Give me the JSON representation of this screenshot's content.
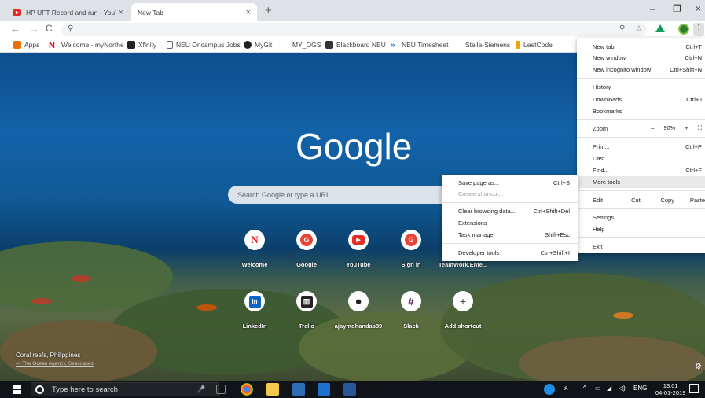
{
  "browser": {
    "tabs": [
      {
        "title": "HP UFT Record and run - YouTub",
        "close": "×"
      },
      {
        "title": "New Tab",
        "close": "×"
      }
    ],
    "new_tab_symbol": "+",
    "window_controls": {
      "minimize": "–",
      "maximize": "❐",
      "close": "×"
    },
    "nav": {
      "back": "←",
      "forward": "→",
      "reload": "C"
    },
    "omnibox": {
      "value": "",
      "search_icon": "search-icon",
      "zoom_icon": "zoom-icon",
      "star_icon": "star-icon"
    },
    "menu_dots": "⋮"
  },
  "bookmarks": [
    {
      "label": "Apps",
      "icon": "apps-grid-icon",
      "color": "#e8710a"
    },
    {
      "label": "Welcome - myNorthe",
      "icon": "netflix-n-icon",
      "color": "#e50914"
    },
    {
      "label": "Xfinity",
      "icon": "xfinity-icon",
      "color": "#222222"
    },
    {
      "label": "NEU Oncampus Jobs",
      "icon": "page-icon",
      "color": "#ffffff"
    },
    {
      "label": "MyGit",
      "icon": "github-icon",
      "color": "#222222"
    },
    {
      "label": "MY_OGS",
      "icon": "",
      "color": "#ffffff"
    },
    {
      "label": "Blackboard NEU",
      "icon": "blackboard-icon",
      "color": "#333333"
    },
    {
      "label": "NEU Timesheet",
      "icon": "chevron-icon",
      "color": "#1a73e8"
    },
    {
      "label": "Stella-Siemens",
      "icon": "",
      "color": "#ffffff"
    },
    {
      "label": "LeetCode",
      "icon": "leetcode-icon",
      "color": "#f0a500"
    }
  ],
  "ntp": {
    "logo": "Google",
    "search_placeholder": "Search Google or type a URL",
    "shortcuts_row1": [
      {
        "label": "Welcome",
        "letter": "N",
        "color": "#e50914"
      },
      {
        "label": "Google",
        "letter": "G",
        "color": "#ea4335"
      },
      {
        "label": "YouTube",
        "letter": "▶",
        "color": "#e52d27"
      },
      {
        "label": "Sign in",
        "letter": "G",
        "color": "#ea4335"
      },
      {
        "label": "TeamWork.Ente...",
        "letter": "",
        "color": "#333333"
      }
    ],
    "shortcuts_row2": [
      {
        "label": "LinkedIn",
        "letter": "in",
        "color": "#0a66c2"
      },
      {
        "label": "Trello",
        "letter": "▥",
        "color": "#222222"
      },
      {
        "label": "ajaymohandas89",
        "letter": "●",
        "color": "#222222"
      },
      {
        "label": "Slack",
        "letter": "#",
        "color": "#4a154b"
      },
      {
        "label": "Add shortcut",
        "letter": "+",
        "color": "#444444"
      }
    ],
    "credit": "Coral reefs, Philippines",
    "credit_sub": "— The Ocean Agency, Seascapes"
  },
  "chrome_menu": {
    "new_tab": {
      "label": "New tab",
      "shortcut": "Ctrl+T"
    },
    "new_window": {
      "label": "New window",
      "shortcut": "Ctrl+N"
    },
    "incognito": {
      "label": "New incognito window",
      "shortcut": "Ctrl+Shift+N"
    },
    "history": "History",
    "downloads": {
      "label": "Downloads",
      "shortcut": "Ctrl+J"
    },
    "bookmarks": "Bookmarks",
    "zoom": {
      "label": "Zoom",
      "minus": "–",
      "value": "90%",
      "plus": "+",
      "fullscreen": "⛶"
    },
    "print": {
      "label": "Print...",
      "shortcut": "Ctrl+P"
    },
    "cast": "Cast...",
    "find": {
      "label": "Find...",
      "shortcut": "Ctrl+F"
    },
    "more_tools": "More tools",
    "edit": {
      "label": "Edit",
      "cut": "Cut",
      "copy": "Copy",
      "paste": "Paste"
    },
    "settings": "Settings",
    "help": "Help",
    "exit": "Exit"
  },
  "more_tools_menu": {
    "save_page": {
      "label": "Save page as...",
      "shortcut": "Ctrl+S"
    },
    "create_shortcut": "Create shortcut...",
    "clear_browsing": {
      "label": "Clear browsing data...",
      "shortcut": "Ctrl+Shift+Del"
    },
    "extensions": "Extensions",
    "task_manager": {
      "label": "Task manager",
      "shortcut": "Shift+Esc"
    },
    "dev_tools": {
      "label": "Developer tools",
      "shortcut": "Ctrl+Shift+I"
    }
  },
  "taskbar": {
    "search_placeholder": "Type here to search",
    "mic": "🎤",
    "apps": [
      {
        "name": "task-view",
        "color": "#2b2f33"
      },
      {
        "name": "chrome",
        "color": "#f4b400"
      },
      {
        "name": "file-explorer",
        "color": "#f2c94c"
      },
      {
        "name": "snipping",
        "color": "#2d6db5"
      },
      {
        "name": "azure",
        "color": "#1f6fd0"
      },
      {
        "name": "word",
        "color": "#2b579a"
      }
    ],
    "tray": {
      "lang": "ENG"
    },
    "time": "13:01",
    "date": "04-01-2019"
  }
}
